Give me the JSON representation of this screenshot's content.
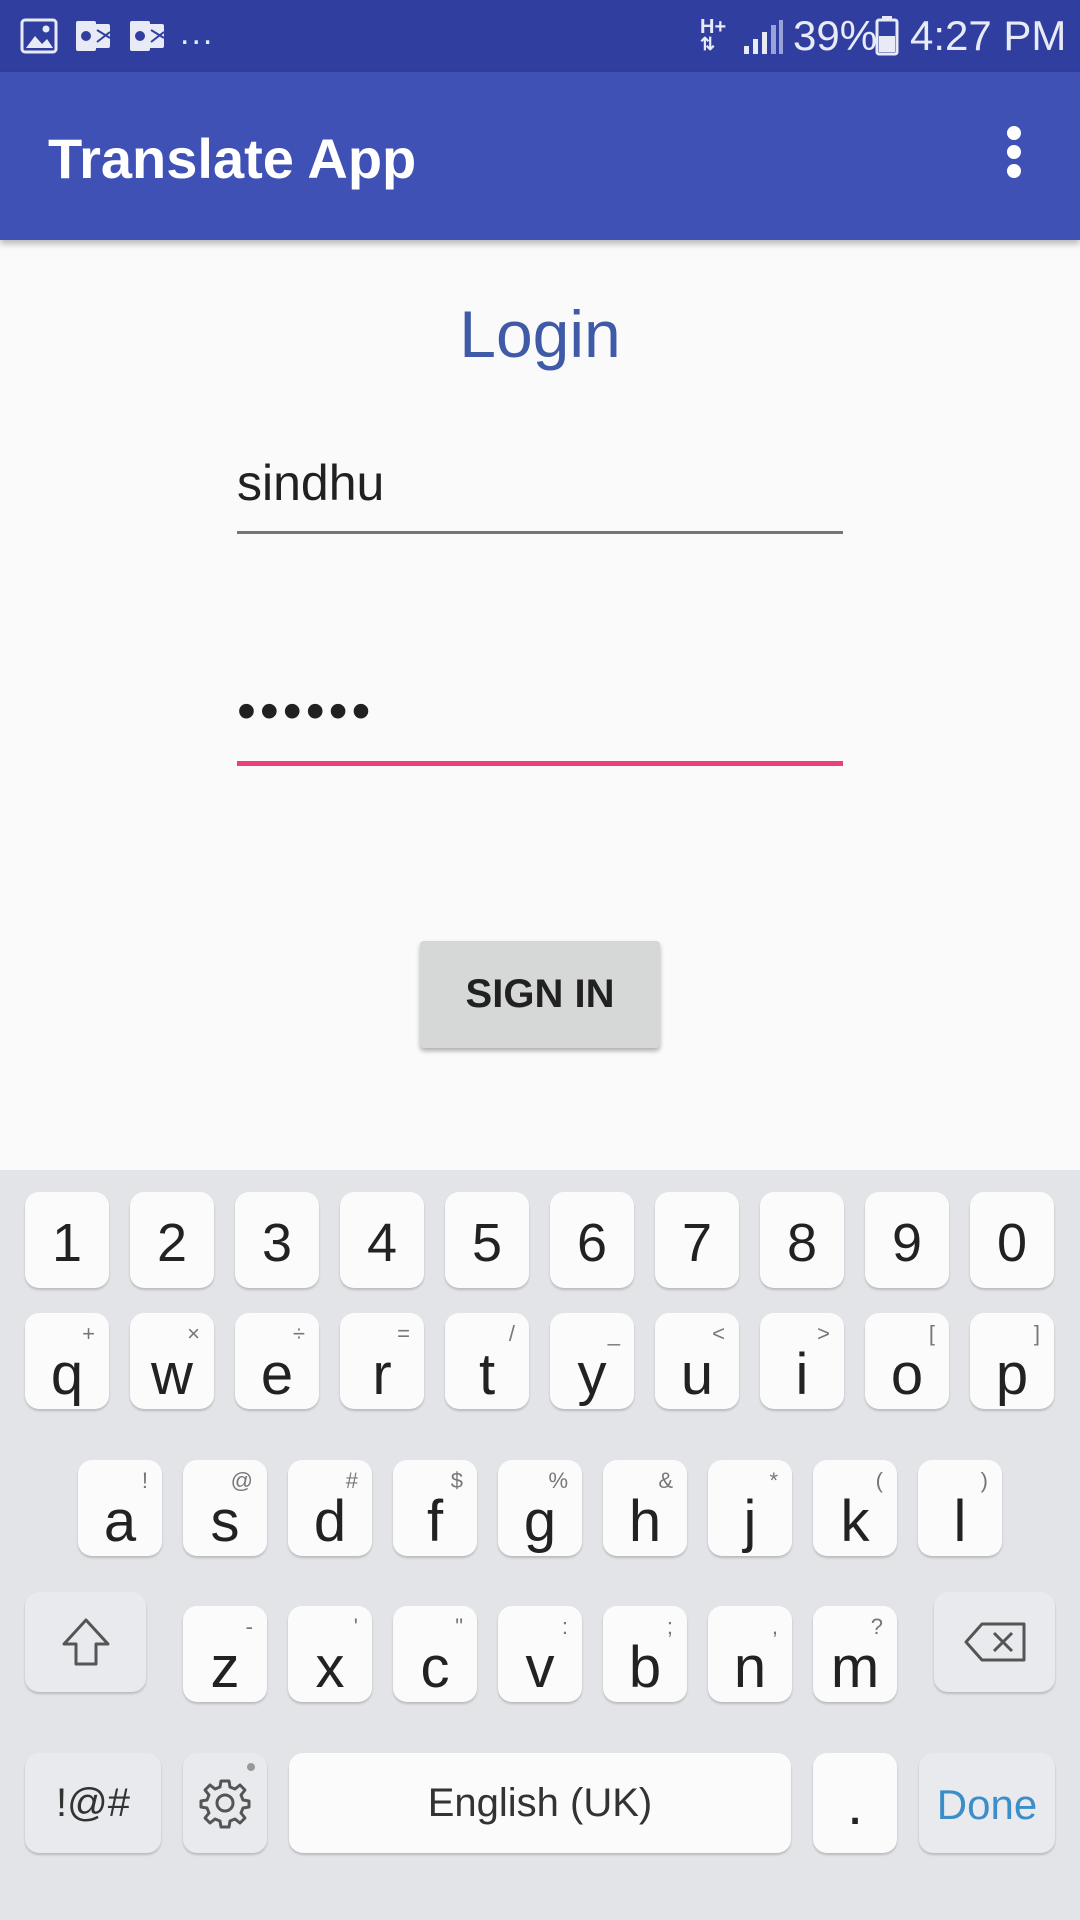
{
  "status_bar": {
    "more_notifications": "...",
    "network_type": "H+",
    "battery_percent": "39%",
    "time": "4:27 PM"
  },
  "app_bar": {
    "title": "Translate App"
  },
  "login": {
    "heading": "Login",
    "username_value": "sindhu",
    "password_value": "••••••",
    "sign_in_label": "SIGN IN"
  },
  "keyboard": {
    "number_row": [
      "1",
      "2",
      "3",
      "4",
      "5",
      "6",
      "7",
      "8",
      "9",
      "0"
    ],
    "row1": [
      {
        "key": "q",
        "hint": "+"
      },
      {
        "key": "w",
        "hint": "×"
      },
      {
        "key": "e",
        "hint": "÷"
      },
      {
        "key": "r",
        "hint": "="
      },
      {
        "key": "t",
        "hint": "/"
      },
      {
        "key": "y",
        "hint": "_"
      },
      {
        "key": "u",
        "hint": "<"
      },
      {
        "key": "i",
        "hint": ">"
      },
      {
        "key": "o",
        "hint": "["
      },
      {
        "key": "p",
        "hint": "]"
      }
    ],
    "row2": [
      {
        "key": "a",
        "hint": "!"
      },
      {
        "key": "s",
        "hint": "@"
      },
      {
        "key": "d",
        "hint": "#"
      },
      {
        "key": "f",
        "hint": "$"
      },
      {
        "key": "g",
        "hint": "%"
      },
      {
        "key": "h",
        "hint": "&"
      },
      {
        "key": "j",
        "hint": "*"
      },
      {
        "key": "k",
        "hint": "("
      },
      {
        "key": "l",
        "hint": ")"
      }
    ],
    "row3": [
      {
        "key": "z",
        "hint": "-"
      },
      {
        "key": "x",
        "hint": "'"
      },
      {
        "key": "c",
        "hint": "\""
      },
      {
        "key": "v",
        "hint": ":"
      },
      {
        "key": "b",
        "hint": ";"
      },
      {
        "key": "n",
        "hint": ","
      },
      {
        "key": "m",
        "hint": "?"
      }
    ],
    "symbols_label": "!@#",
    "space_label": "English (UK)",
    "period_label": ".",
    "done_label": "Done",
    "icons": {
      "shift": "shift-arrow-icon",
      "backspace": "backspace-icon",
      "settings": "gear-icon"
    }
  },
  "colors": {
    "status_bar": "#303f9f",
    "app_bar": "#3f51b5",
    "heading": "#3f5aa6",
    "active_underline": "#ec407a",
    "done_text": "#3b8ec9"
  }
}
